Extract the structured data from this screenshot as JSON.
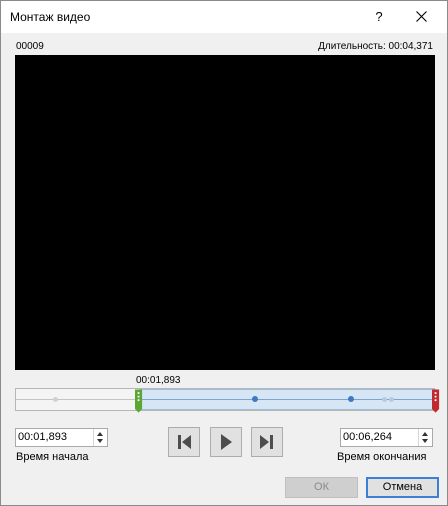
{
  "window": {
    "title": "Монтаж видео",
    "help_label": "?"
  },
  "header": {
    "clip_name": "00009",
    "duration_text": "Длительность: 00:04,371"
  },
  "timeline": {
    "current_time": "00:01,893",
    "duration_seconds": 4.371,
    "start_seconds": 1.893,
    "end_seconds": 6.264,
    "start_handle_color": "#5aa832",
    "end_handle_color": "#c0292e",
    "selection_color": "#d7e6f5"
  },
  "start": {
    "value": "00:01,893",
    "label": "Время начала"
  },
  "end": {
    "value": "00:06,264",
    "label": "Время окончания"
  },
  "controls": {
    "previous_frame_icon": "previous-frame-icon",
    "play_icon": "play-icon",
    "next_frame_icon": "next-frame-icon"
  },
  "buttons": {
    "ok": "ОК",
    "cancel": "Отмена"
  }
}
